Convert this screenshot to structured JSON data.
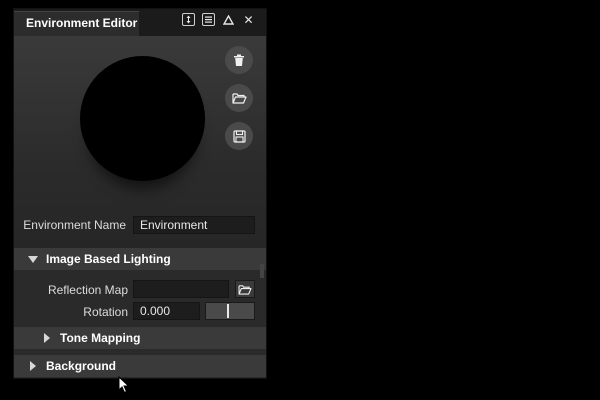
{
  "panel": {
    "tab_title": "Environment Editor",
    "titlebar_icons": [
      "pin-icon",
      "menu-icon",
      "collapse-icon",
      "close-icon"
    ],
    "close_glyph": "✕"
  },
  "preview": {
    "actions": [
      "delete-icon",
      "open-folder-icon",
      "save-icon"
    ]
  },
  "environment": {
    "name_label": "Environment Name",
    "name_value": "Environment"
  },
  "ibl": {
    "title": "Image Based Lighting",
    "expanded": true,
    "reflection_map_label": "Reflection Map",
    "reflection_map_value": "",
    "rotation_label": "Rotation",
    "rotation_value": "0.000",
    "rotation_slider_fraction": 0.5,
    "tone_mapping_title": "Tone Mapping"
  },
  "background": {
    "title": "Background"
  },
  "colors": {
    "panel_bg": "#2a2a2a",
    "header_bg": "#3a3a3a",
    "field_bg": "#1d1d1d",
    "text": "#e6e6e6"
  }
}
